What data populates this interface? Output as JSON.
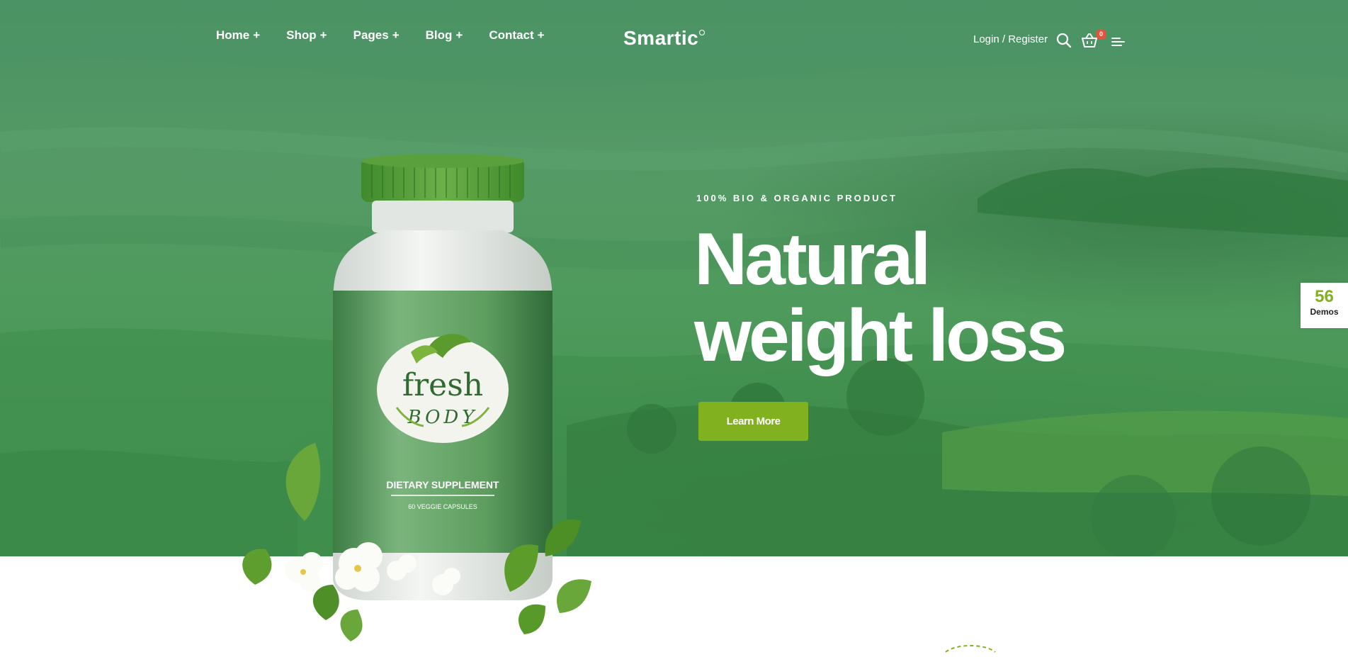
{
  "nav": {
    "items": [
      {
        "label": "Home",
        "suffix": "+"
      },
      {
        "label": "Shop",
        "suffix": "+"
      },
      {
        "label": "Pages",
        "suffix": "+"
      },
      {
        "label": "Blog",
        "suffix": "+"
      },
      {
        "label": "Contact",
        "suffix": "+"
      }
    ]
  },
  "brand": {
    "logo": "Smartic"
  },
  "header": {
    "login_label": "Login / Register",
    "cart_count": "0",
    "icons": [
      "search-icon",
      "cart-icon",
      "menu-icon"
    ]
  },
  "hero": {
    "subtitle": "100% BIO & ORGANIC PRODUCT",
    "headline_line1": "Natural",
    "headline_line2": "weight loss",
    "cta_label": "Learn More"
  },
  "product": {
    "brand_word1": "fresh",
    "brand_word2": "BODY",
    "label_title": "DIETARY SUPPLEMENT",
    "label_sub": "60 VEGGIE CAPSULES"
  },
  "demos": {
    "count": "56",
    "label": "Demos"
  },
  "colors": {
    "accent": "#82b11f",
    "hero_green": "#4e9a5c",
    "badge": "#e8523c",
    "white": "#ffffff"
  }
}
